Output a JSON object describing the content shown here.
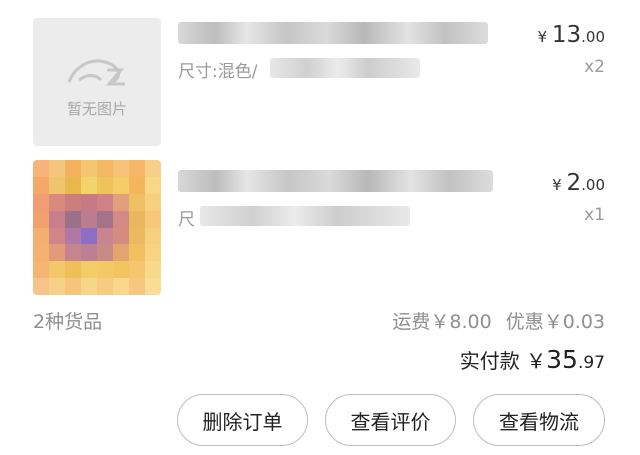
{
  "items": [
    {
      "thumb": {
        "placeholder_text": "暂无图片"
      },
      "spec_label": "尺寸:混色/",
      "price_symbol": "¥",
      "price_int": "13",
      "price_dec": ".00",
      "quantity": "x2"
    },
    {
      "spec_label": "尺",
      "price_symbol": "¥",
      "price_int": "2",
      "price_dec": ".00",
      "quantity": "x1"
    }
  ],
  "summary": {
    "goods_count": "2种货品",
    "shipping": "运费￥8.00",
    "discount": "优惠￥0.03"
  },
  "total": {
    "label": "实付款",
    "symbol": "￥",
    "int": "35",
    "dec": ".97"
  },
  "actions": {
    "delete": "删除订单",
    "review": "查看评价",
    "logistics": "查看物流"
  }
}
